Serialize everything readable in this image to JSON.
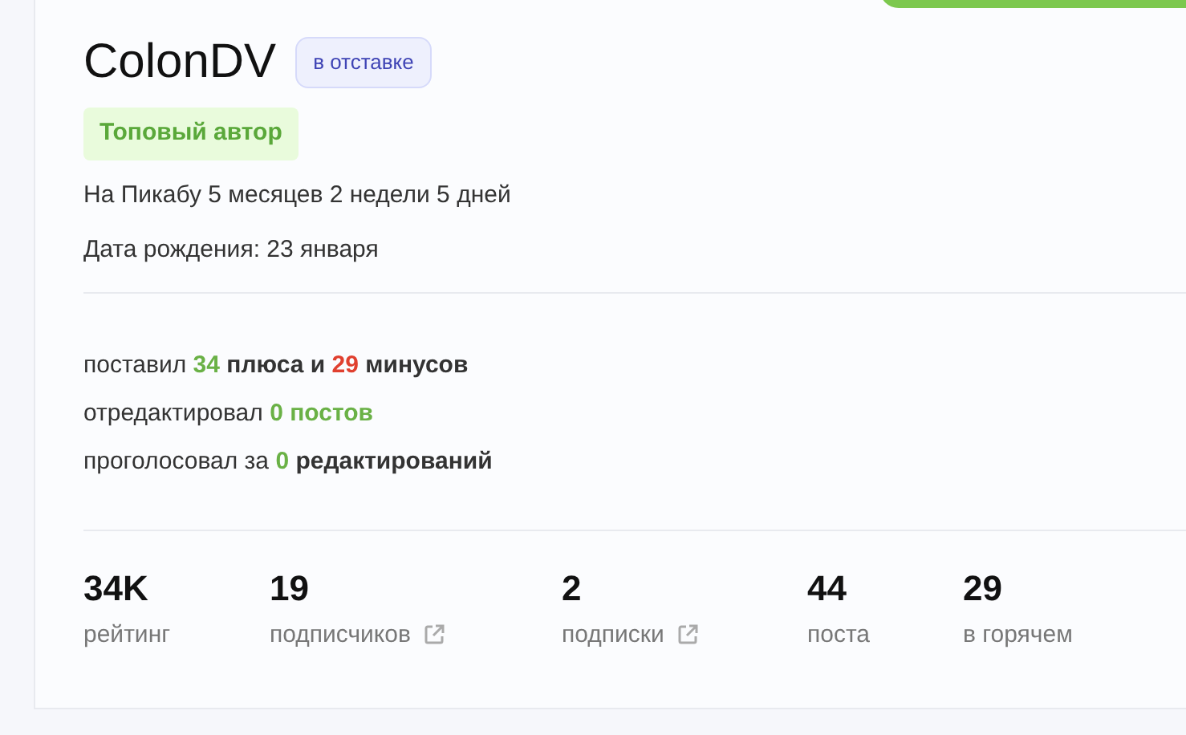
{
  "profile": {
    "username": "ColonDV",
    "status_badge": "в отставке",
    "award": "Топовый автор",
    "info": [
      "На Пикабу 5 месяцев 2 недели 5 дней",
      "Дата рождения: 23 января"
    ]
  },
  "activity": [
    [
      {
        "text": "поставил ",
        "bold": false
      },
      {
        "text": "34",
        "bold": true,
        "color": "#6ab146"
      },
      {
        "text": " плюса и ",
        "bold": true
      },
      {
        "text": "29",
        "bold": true,
        "color": "#e0402f"
      },
      {
        "text": " минусов",
        "bold": true
      }
    ],
    [
      {
        "text": "отредактировал ",
        "bold": false
      },
      {
        "text": "0 постов",
        "bold": true,
        "color": "#6ab146"
      }
    ],
    [
      {
        "text": "проголосовал за ",
        "bold": false
      },
      {
        "text": "0",
        "bold": true,
        "color": "#6ab146"
      },
      {
        "text": " редактирований",
        "bold": true
      }
    ]
  ],
  "stats": [
    {
      "value": "34K",
      "label": "рейтинг",
      "link": false
    },
    {
      "value": "19",
      "label": "подписчиков",
      "link": true
    },
    {
      "value": "2",
      "label": "подписки",
      "link": true
    },
    {
      "value": "44",
      "label": "поста",
      "link": false
    },
    {
      "value": "29",
      "label": "в горячем",
      "link": false
    }
  ]
}
